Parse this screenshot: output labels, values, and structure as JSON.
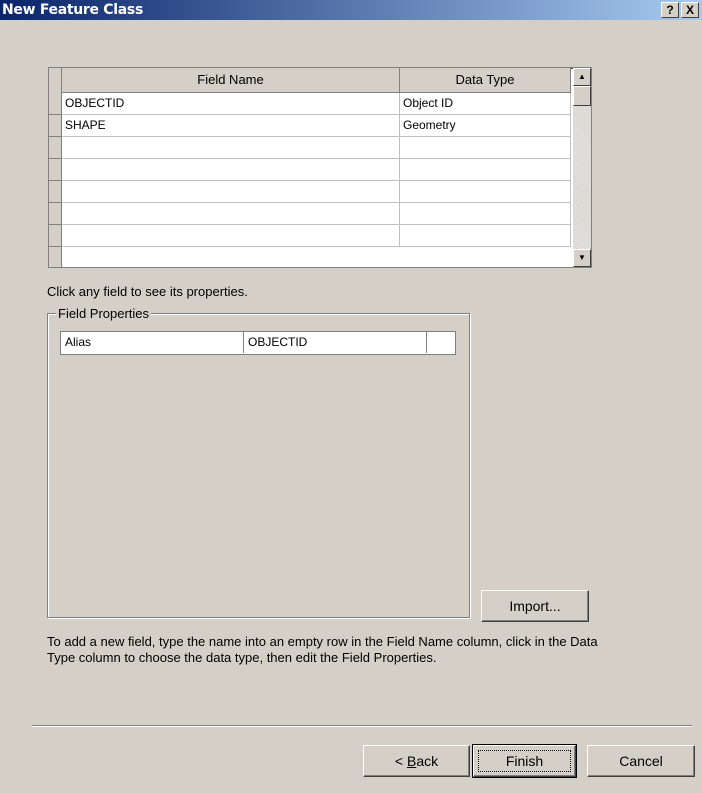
{
  "window": {
    "title": "New Feature Class",
    "help_label": "?",
    "close_label": "X"
  },
  "grid": {
    "columns": [
      "Field Name",
      "Data Type"
    ],
    "rows": [
      [
        "OBJECTID",
        "Object ID"
      ],
      [
        "SHAPE",
        "Geometry"
      ],
      [
        "",
        ""
      ],
      [
        "",
        ""
      ],
      [
        "",
        ""
      ],
      [
        "",
        ""
      ],
      [
        "",
        ""
      ]
    ]
  },
  "hint": "Click any field to see its properties.",
  "field_properties": {
    "group_label": "Field Properties",
    "rows": [
      {
        "name": "Alias",
        "value": "OBJECTID"
      }
    ],
    "import_label": "Import..."
  },
  "description": "To add a new field, type the name into an empty row in the Field Name column, click in the Data Type column to choose the data type, then edit the Field Properties.",
  "buttons": {
    "back": "< Back",
    "finish": "Finish",
    "cancel": "Cancel"
  }
}
